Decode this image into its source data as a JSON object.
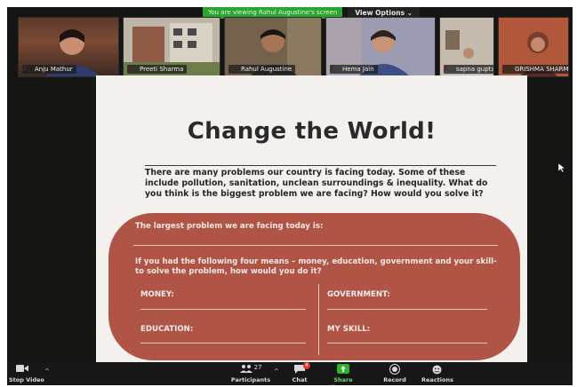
{
  "header": {
    "banner_text": "You are viewing Rahul Augustine's screen",
    "view_options": "View Options ⌄"
  },
  "participants_tiles": [
    {
      "name": "Anju Mathur"
    },
    {
      "name": "Preeti Sharma"
    },
    {
      "name": "Rahul Augustine"
    },
    {
      "name": "Hema Jain"
    },
    {
      "name": "sapna gupta"
    },
    {
      "name": "GRISHMA SHARMA"
    }
  ],
  "slide": {
    "title": "Change the World!",
    "intro": "There are many problems our country is facing today. Some of these include pollution, sanitation, unclean surroundings & inequality. What do you think is the biggest problem we are facing? How would you solve it?",
    "q1": "The largest problem we are facing today is:",
    "q2": "If you had the following four means – money, education, government and your skill- to solve the problem, how would you do it?",
    "money": "MONEY:",
    "government": "GOVERNMENT:",
    "education": "EDUCATION:",
    "my_skill": "MY SKILL:"
  },
  "toolbar": {
    "video_label": "Stop Video",
    "participants_label": "Participants",
    "participants_count": "27",
    "chat_label": "Chat",
    "chat_badge": "4",
    "share_label": "Share Screen",
    "record_label": "Record",
    "reactions_label": "Reactions",
    "caret": "^"
  },
  "colors": {
    "pill": "#b05546",
    "banner": "#2aa52f",
    "share": "#2db52a"
  }
}
